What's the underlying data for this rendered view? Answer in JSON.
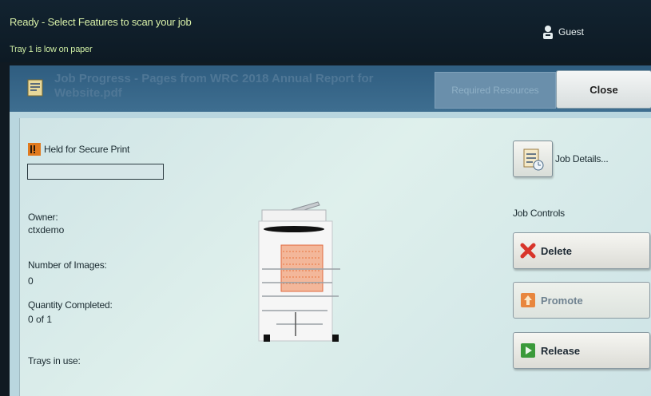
{
  "status_bar": {
    "message": "Ready -  Select Features to scan your job",
    "tray_warning": "Tray 1 is low on paper",
    "user": "Guest"
  },
  "job_window": {
    "title": "Job Progress - Pages from WRC 2018 Annual Report for Website.pdf",
    "required_resources_label": "Required Resources",
    "close_label": "Close"
  },
  "job_info": {
    "status": "Held for Secure Print",
    "owner_label": "Owner:",
    "owner_value": "ctxdemo",
    "images_label": "Number of Images:",
    "images_value": "0",
    "quantity_label": "Quantity Completed:",
    "quantity_value": "0 of 1",
    "trays_label": "Trays in use:"
  },
  "controls": {
    "job_details_label": "Job Details...",
    "job_controls_heading": "Job Controls",
    "delete_label": "Delete",
    "promote_label": "Promote",
    "release_label": "Release"
  },
  "colors": {
    "status_text": "#d8f0a8",
    "title_bar": "#3e6e90",
    "panel_bg": "#d6eaea"
  }
}
